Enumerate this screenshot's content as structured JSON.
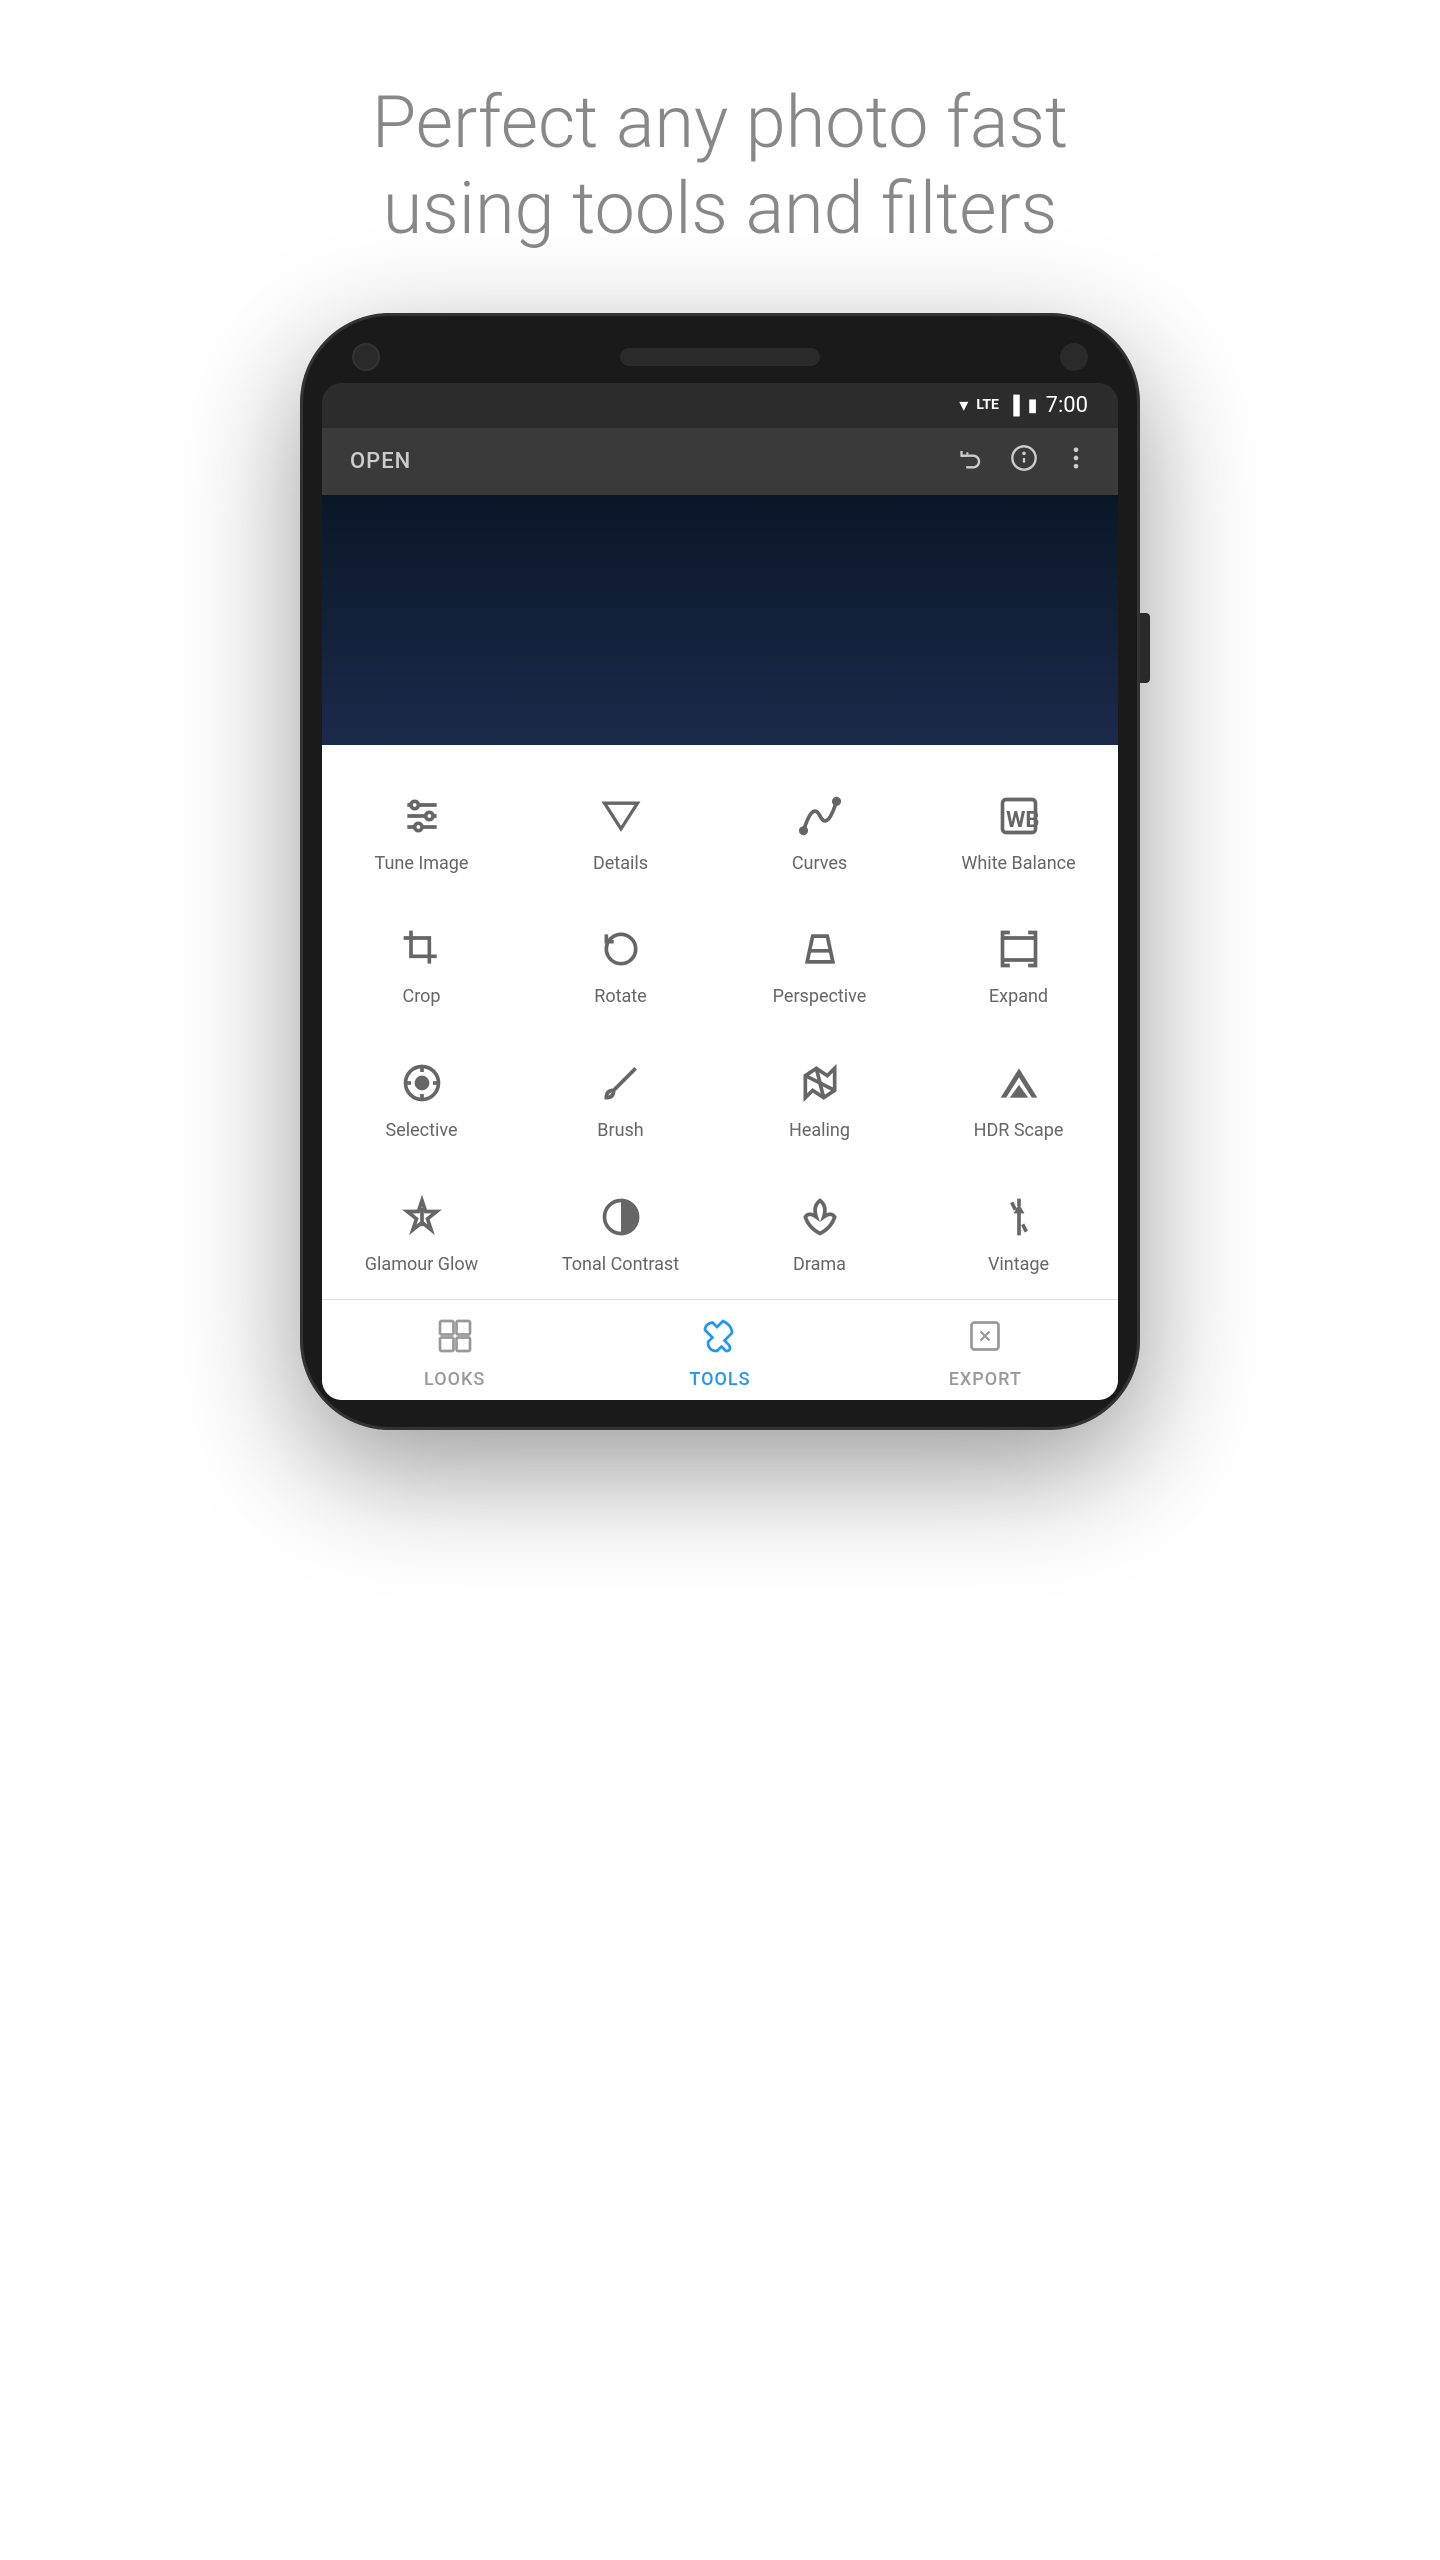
{
  "hero": {
    "line1": "Perfect any photo fast",
    "line2": "using tools and filters"
  },
  "status_bar": {
    "wifi": "▼",
    "lte": "LTE",
    "signal": "▐",
    "battery": "🔋",
    "time": "7:00"
  },
  "app_bar": {
    "open_label": "OPEN",
    "icons": [
      "undo",
      "info",
      "more"
    ]
  },
  "tools": [
    {
      "id": "tune-image",
      "label": "Tune Image",
      "icon": "tune"
    },
    {
      "id": "details",
      "label": "Details",
      "icon": "details"
    },
    {
      "id": "curves",
      "label": "Curves",
      "icon": "curves"
    },
    {
      "id": "white-balance",
      "label": "White Balance",
      "icon": "wb"
    },
    {
      "id": "crop",
      "label": "Crop",
      "icon": "crop"
    },
    {
      "id": "rotate",
      "label": "Rotate",
      "icon": "rotate"
    },
    {
      "id": "perspective",
      "label": "Perspective",
      "icon": "perspective"
    },
    {
      "id": "expand",
      "label": "Expand",
      "icon": "expand"
    },
    {
      "id": "selective",
      "label": "Selective",
      "icon": "selective"
    },
    {
      "id": "brush",
      "label": "Brush",
      "icon": "brush"
    },
    {
      "id": "healing",
      "label": "Healing",
      "icon": "healing"
    },
    {
      "id": "hdr-scape",
      "label": "HDR Scape",
      "icon": "hdr"
    },
    {
      "id": "glamour-glow",
      "label": "Glamour Glow",
      "icon": "glamour"
    },
    {
      "id": "tonal-contrast",
      "label": "Tonal Contrast",
      "icon": "tonal"
    },
    {
      "id": "drama",
      "label": "Drama",
      "icon": "drama"
    },
    {
      "id": "vintage",
      "label": "Vintage",
      "icon": "vintage"
    }
  ],
  "bottom_nav": [
    {
      "id": "looks",
      "label": "LOOKS",
      "active": false
    },
    {
      "id": "tools",
      "label": "TOOLS",
      "active": true
    },
    {
      "id": "export",
      "label": "EXPORT",
      "active": false
    }
  ]
}
